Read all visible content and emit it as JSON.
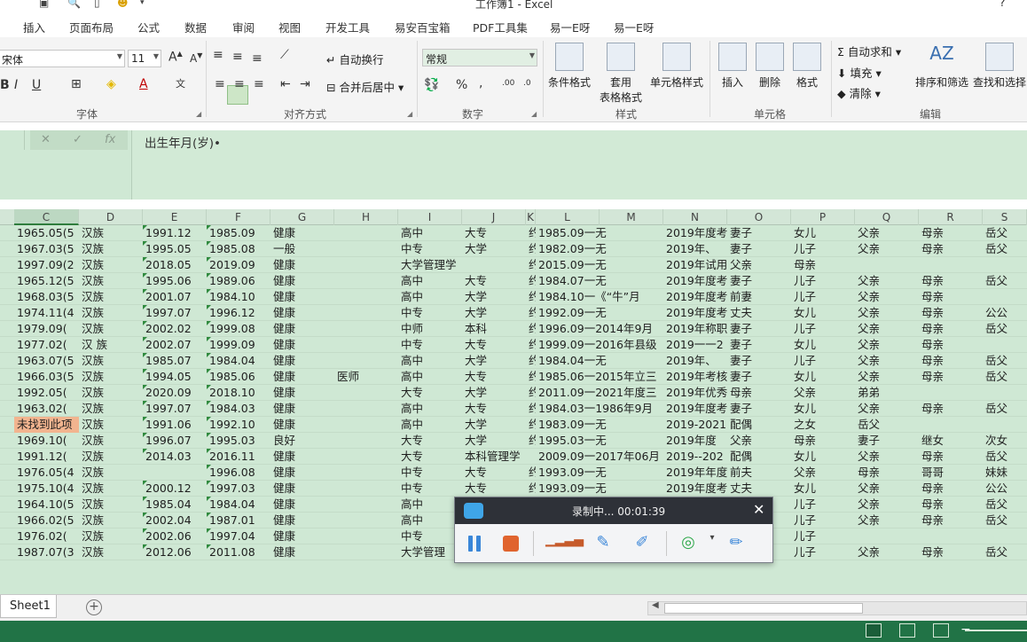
{
  "window": {
    "title": "工作簿1 - Excel",
    "help": "?"
  },
  "menu": {
    "tabs": [
      "插入",
      "页面布局",
      "公式",
      "数据",
      "审阅",
      "视图",
      "开发工具",
      "易安百宝箱",
      "PDF工具集",
      "易一E呀",
      "易一E呀"
    ]
  },
  "ribbon": {
    "font_name": "宋体",
    "font_size": "11",
    "bold": "B",
    "italic": "I",
    "underline": "U",
    "wrap_text": "自动换行",
    "merge_center": "合并后居中",
    "number_format": "常规",
    "percent": "%",
    "comma": ",",
    "cond_format": "条件格式",
    "table_format_1": "套用",
    "table_format_2": "表格格式",
    "cell_style": "单元格样式",
    "insert": "插入",
    "delete": "删除",
    "format": "格式",
    "autosum": "自动求和",
    "fill": "填充",
    "clear": "清除",
    "sort_filter": "排序和筛选",
    "find_select": "查找和选择",
    "groups": {
      "font": "字体",
      "alignment": "对齐方式",
      "number": "数字",
      "styles": "样式",
      "cells": "单元格",
      "editing": "编辑"
    }
  },
  "formula_bar": {
    "fx": "fx",
    "content": "出生年月(岁)•"
  },
  "columns": [
    "C",
    "D",
    "E",
    "F",
    "G",
    "H",
    "I",
    "J",
    "K",
    "L",
    "M",
    "N",
    "O",
    "P",
    "Q",
    "R",
    "S"
  ],
  "rows": [
    [
      "1965.05(5",
      "汉族",
      "1991.12",
      "1985.09",
      "健康",
      "",
      "高中",
      "大专",
      "约",
      "1985.09一无",
      "",
      "2019年度考",
      "妻子",
      "女儿",
      "父亲",
      "母亲",
      "岳父"
    ],
    [
      "1967.03(5",
      "汉族",
      "1995.05",
      "1985.08",
      "一般",
      "",
      "中专",
      "大学",
      "约",
      "1982.09一无",
      "",
      "2019年、",
      "妻子",
      "儿子",
      "父亲",
      "母亲",
      "岳父"
    ],
    [
      "1997.09(2",
      "汉族",
      "2018.05",
      "2019.09",
      "健康",
      "",
      "大学管理学",
      "",
      "约",
      "2015.09一无",
      "",
      "2019年试用",
      "父亲",
      "母亲",
      "",
      "",
      ""
    ],
    [
      "1965.12(5",
      "汉族",
      "1995.06",
      "1989.06",
      "健康",
      "",
      "高中",
      "大专",
      "约",
      "1984.07一无",
      "",
      "2019年度考",
      "妻子",
      "儿子",
      "父亲",
      "母亲",
      "岳父"
    ],
    [
      "1968.03(5",
      "汉族",
      "2001.07",
      "1984.10",
      "健康",
      "",
      "高中",
      "大学",
      "约",
      "1984.10一《“牛”月",
      "",
      "2019年度考",
      "前妻",
      "儿子",
      "父亲",
      "母亲",
      ""
    ],
    [
      "1974.11(4",
      "汉族",
      "1997.07",
      "1996.12",
      "健康",
      "",
      "中专",
      "大学",
      "约",
      "1992.09一无",
      "",
      "2019年度考",
      "丈夫",
      "女儿",
      "父亲",
      "母亲",
      "公公"
    ],
    [
      "1979.09(",
      "汉族",
      "2002.02",
      "1999.08",
      "健康",
      "",
      "中师",
      "本科",
      "约",
      " 1996.09一2014年9月",
      "",
      "2019年称职",
      "妻子",
      "儿子",
      "父亲",
      "母亲",
      "岳父"
    ],
    [
      "1977.02(",
      "汉 族",
      "2002.07",
      "1999.09",
      "健康",
      "",
      "中专",
      "大专",
      "约",
      "1999.09一2016年县级",
      "",
      "2019一一2",
      "妻子",
      "女儿",
      "父亲",
      "母亲",
      ""
    ],
    [
      "1963.07(5",
      "汉族",
      "1985.07",
      "1984.04",
      "健康",
      "",
      "高中",
      "大学",
      "约",
      "1984.04一无",
      "",
      "2019年、",
      "妻子",
      "儿子",
      "父亲",
      "母亲",
      "岳父"
    ],
    [
      "1966.03(5",
      "汉族",
      "1994.05",
      "1985.06",
      "健康",
      "医师",
      "高中",
      "大专",
      "约",
      "1985.06一2015年立三",
      "",
      "2019年考核",
      "妻子",
      "女儿",
      "父亲",
      "母亲",
      "岳父"
    ],
    [
      "1992.05(",
      "汉族",
      "2020.09",
      "2018.10",
      "健康",
      "",
      "大专",
      "大学",
      "约",
      "2011.09一2021年度三",
      "",
      "2019年优秀",
      "母亲",
      "父亲",
      "弟弟",
      "",
      ""
    ],
    [
      "1963.02(",
      "汉族",
      "1997.07",
      "1984.03",
      "健康",
      "",
      "高中",
      "大专",
      "约",
      "1984.03一1986年9月",
      "",
      "2019年度考",
      "妻子",
      "女儿",
      "父亲",
      "母亲",
      "岳父"
    ],
    [
      "未找到此项",
      "汉族",
      "1991.06",
      "1992.10",
      "健康",
      "",
      "高中",
      "大学",
      "约",
      "1983.09一无",
      "",
      "2019-2021",
      "配偶",
      "之女",
      "岳父",
      "",
      ""
    ],
    [
      "1969.10(",
      "汉族",
      "1996.07",
      "1995.03",
      "良好",
      "",
      "大专",
      "大学",
      "约",
      "1995.03一无",
      "",
      "2019年度",
      "父亲",
      "母亲",
      "妻子",
      "继女",
      "次女"
    ],
    [
      "1991.12(",
      "汉族",
      "2014.03",
      "2016.11",
      "健康",
      "",
      "大专",
      "本科管理学",
      "",
      "2009.09一2017年06月",
      "",
      "2019--202",
      "配偶",
      "女儿",
      "父亲",
      "母亲",
      "岳父"
    ],
    [
      "1976.05(4",
      "汉族",
      "",
      "1996.08",
      "健康",
      "",
      "中专",
      "大专",
      "约",
      "1993.09一无",
      "",
      "2019年年度",
      "前夫",
      "父亲",
      "母亲",
      "哥哥",
      "妹妹"
    ],
    [
      "1975.10(4",
      "汉族",
      "2000.12",
      "1997.03",
      "健康",
      "",
      "中专",
      "大专",
      "约",
      "1993.09一无",
      "",
      "2019年度考",
      "丈夫",
      "女儿",
      "父亲",
      "母亲",
      "公公"
    ],
    [
      "1964.10(5",
      "汉族",
      "1985.04",
      "1984.04",
      "健康",
      "",
      "高中",
      "",
      "",
      "",
      "",
      "",
      "",
      "儿子",
      "父亲",
      "母亲",
      "岳父"
    ],
    [
      "1966.02(5",
      "汉族",
      "2002.04",
      "1987.01",
      "健康",
      "",
      "高中",
      "",
      "",
      "",
      "",
      "",
      "",
      "儿子",
      "父亲",
      "母亲",
      "岳父"
    ],
    [
      "1976.02(",
      " 汉族",
      "2002.06",
      "1997.04",
      "健康",
      "",
      "中专",
      "",
      "",
      "",
      "",
      "",
      "",
      "儿子",
      "",
      "",
      ""
    ],
    [
      "1987.07(3",
      "汉族",
      "2012.06",
      "2011.08",
      "健康",
      "",
      "大学管理",
      "",
      "",
      "",
      "",
      "",
      "",
      "儿子",
      "父亲",
      "母亲",
      "岳父"
    ]
  ],
  "recorder": {
    "title": "录制中... 00:01:39",
    "close": "✕"
  },
  "sheet": {
    "tab": "Sheet1",
    "add": "+"
  }
}
